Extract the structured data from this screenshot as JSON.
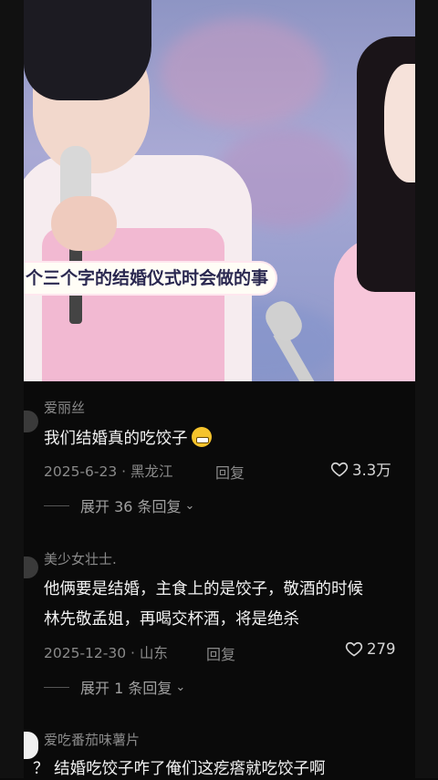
{
  "video": {
    "caption": "个三个字的结婚仪式时会做的事"
  },
  "comments": [
    {
      "user": "爱丽丝",
      "text_lines": [
        "我们结婚真的吃饺子"
      ],
      "date": "2025-6-23",
      "location": "黑龙江",
      "reply_label": "回复",
      "likes": "3.3万",
      "expand": "展开 36 条回复"
    },
    {
      "user": "美少女壮士.",
      "text_lines": [
        "他俩要是结婚，主食上的是饺子，敬酒的时候",
        "林先敬孟姐，再喝交杯酒，将是绝杀"
      ],
      "date": "2025-12-30",
      "location": "山东",
      "reply_label": "回复",
      "likes": "279",
      "expand": "展开 1 条回复"
    },
    {
      "user": "爱吃番茄味薯片",
      "text_lines": [
        "？ 结婚吃饺子咋了俺们这疙瘩就吃饺子啊"
      ]
    }
  ],
  "colors": {
    "background": "#0a0a0a",
    "caption_text": "#2a2850",
    "muted": "#8a8a8a"
  },
  "icons": [
    "heart-icon",
    "chevron-down-icon",
    "grin-emoji-icon"
  ]
}
